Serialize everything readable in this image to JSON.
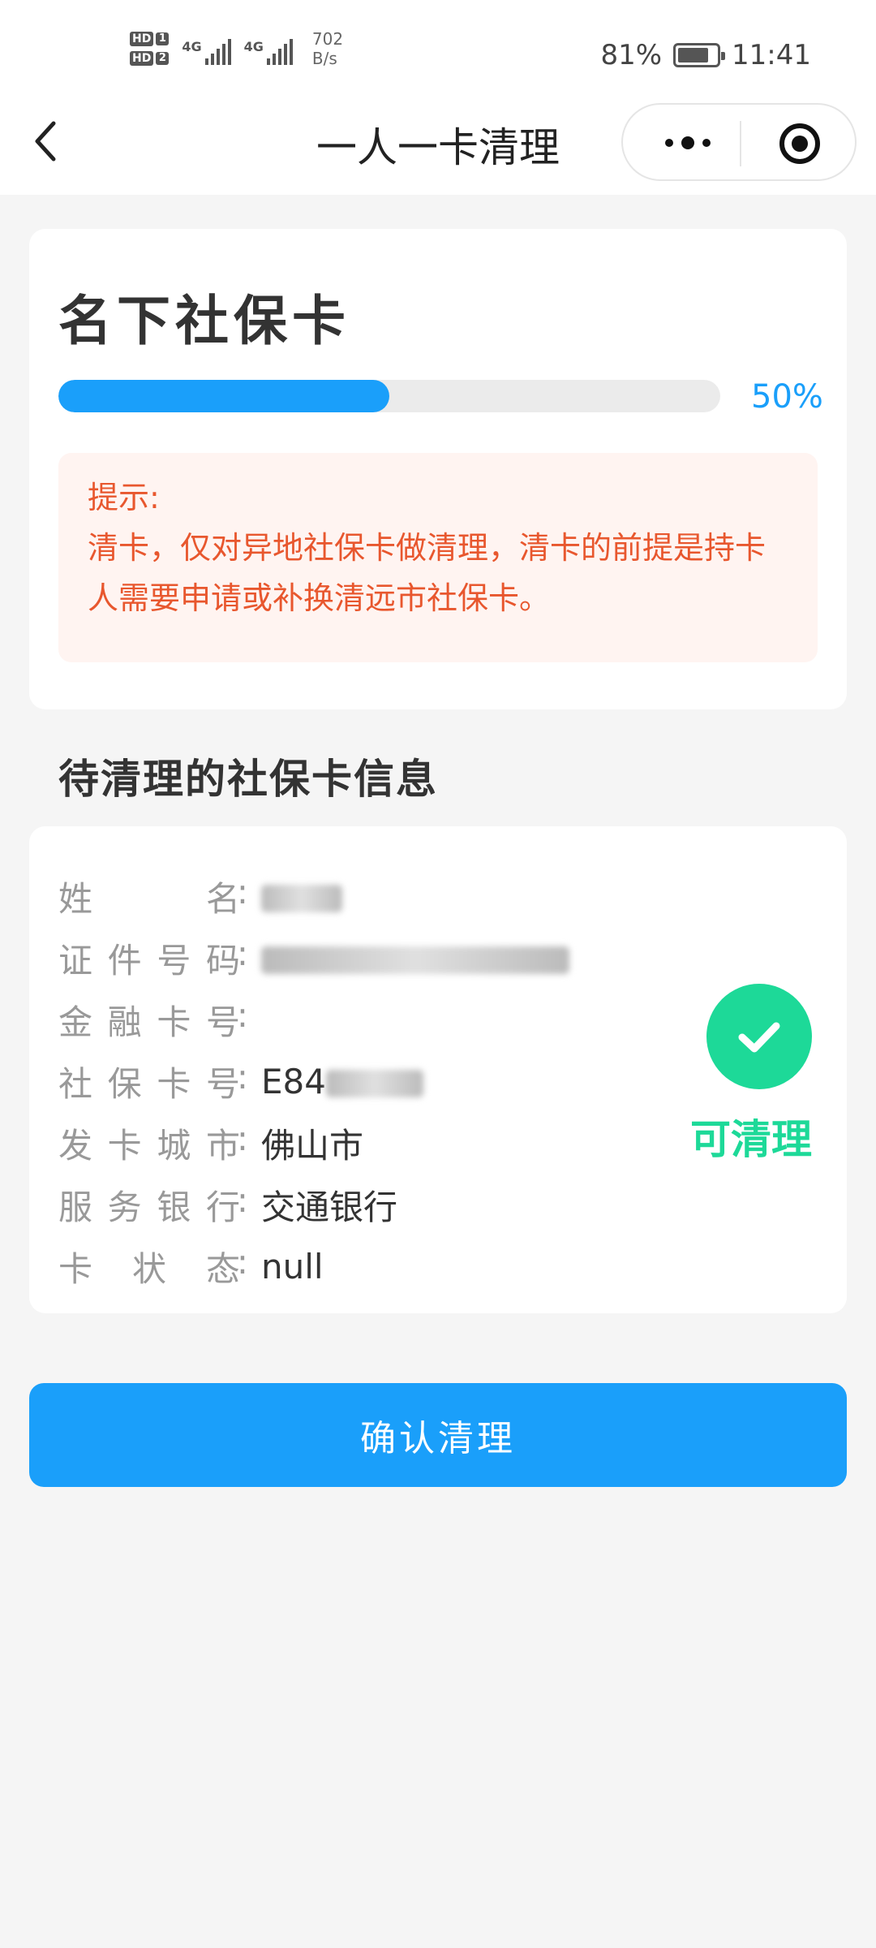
{
  "status_bar": {
    "sim1": "HD",
    "sim1_num": "1",
    "sim2": "HD",
    "sim2_num": "2",
    "signal1_label": "4G",
    "signal2_label": "4G",
    "net_speed_value": "702",
    "net_speed_unit": "B/s",
    "battery": "81%",
    "battery_level": 0.81,
    "time": "11:41"
  },
  "nav": {
    "title": "一人一卡清理",
    "back_icon": "chevron-left-icon",
    "more_icon": "more-dots-icon",
    "close_icon": "target-icon"
  },
  "progress_card": {
    "title": "名下社保卡",
    "progress_value": 0.5,
    "progress_label": "50%",
    "tip_title": "提示:",
    "tip_text": "清卡，仅对异地社保卡做清理，清卡的前提是持卡人需要申请或补换清远市社保卡。"
  },
  "section_title": "待清理的社保卡信息",
  "info": {
    "rows": [
      {
        "label_chars": [
          "姓",
          "名"
        ],
        "value": ""
      },
      {
        "label_chars": [
          "证",
          "件",
          "号",
          "码"
        ],
        "value": ""
      },
      {
        "label_chars": [
          "金",
          "融",
          "卡",
          "号"
        ],
        "value": ""
      },
      {
        "label_chars": [
          "社",
          "保",
          "卡",
          "号"
        ],
        "value": "E84"
      },
      {
        "label_chars": [
          "发",
          "卡",
          "城",
          "市"
        ],
        "value": "佛山市"
      },
      {
        "label_chars": [
          "服",
          "务",
          "银",
          "行"
        ],
        "value": "交通银行"
      },
      {
        "label_chars": [
          "卡",
          "状",
          "态"
        ],
        "value": "null"
      }
    ],
    "colon": ":",
    "status_icon": "check-circle-icon",
    "status_text": "可清理"
  },
  "colors": {
    "primary": "#1a9ffa",
    "success": "#1dd998",
    "warning_text": "#e8572e",
    "warning_bg": "#fff4f1"
  },
  "confirm_button": "确认清理"
}
